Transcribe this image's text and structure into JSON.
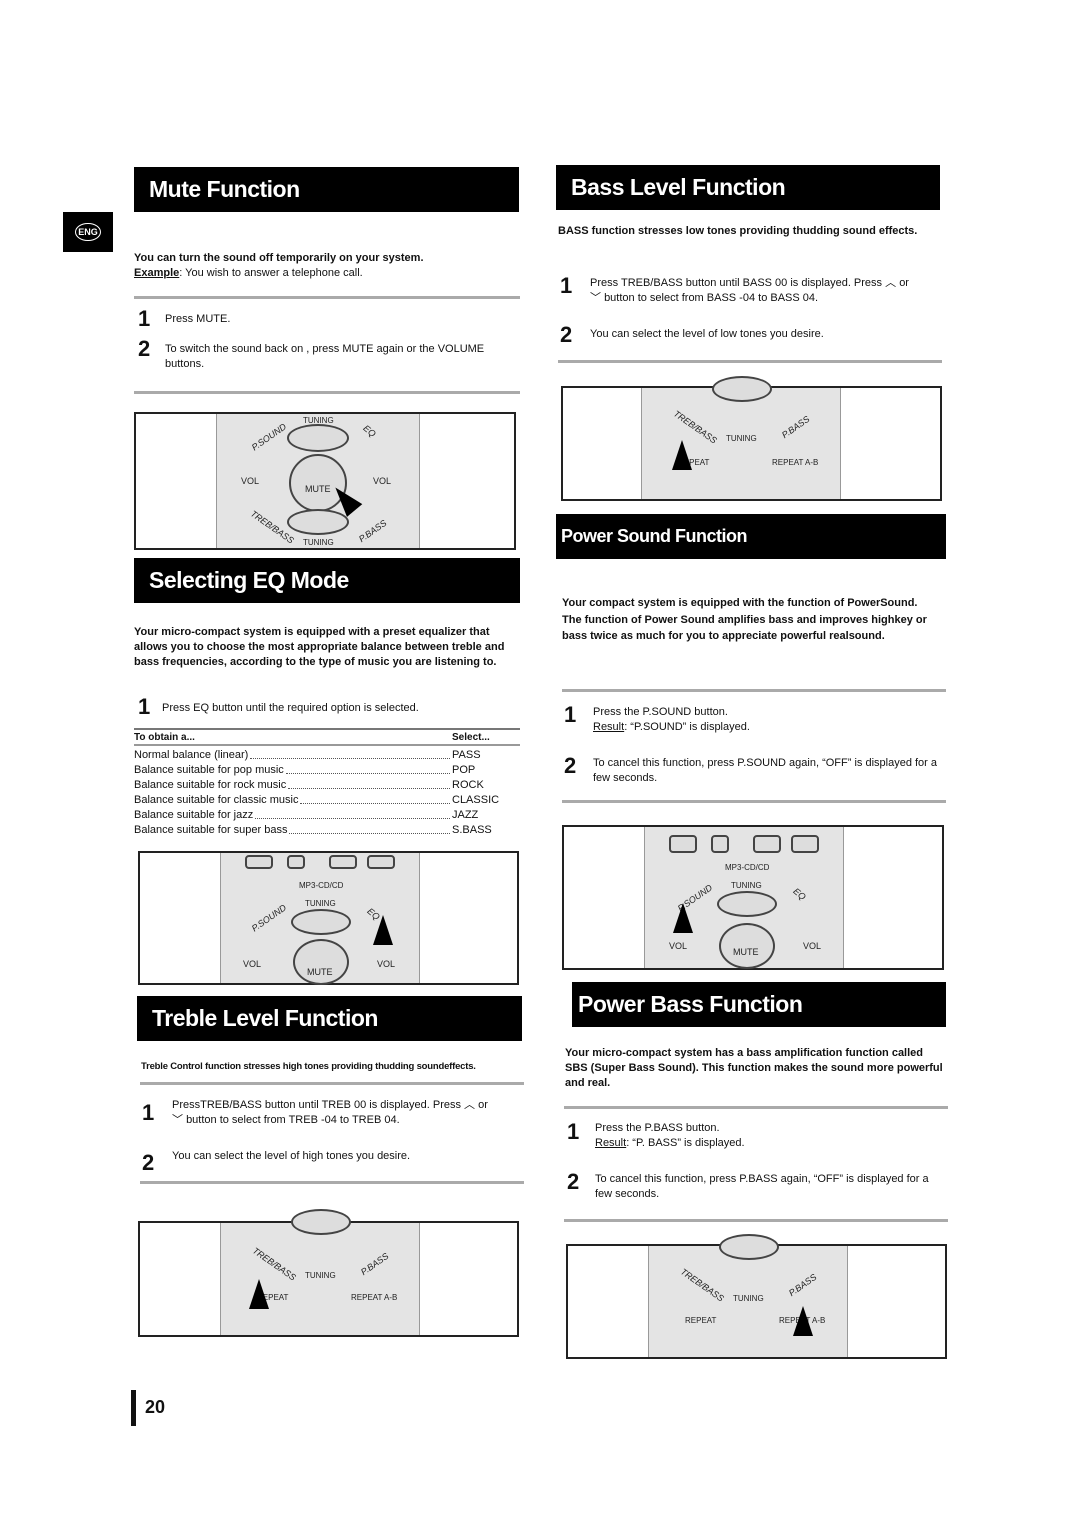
{
  "lang_badge": "ENG",
  "page_number": "20",
  "mute": {
    "title": "Mute Function",
    "intro": "You can turn the sound off temporarily on your system.",
    "example_label": "Example",
    "example_text": ": You wish to answer a telephone call.",
    "step1": "Press MUTE.",
    "step2": "To switch the sound back on , press MUTE again or the VOLUME buttons."
  },
  "eq": {
    "title": "Selecting  EQ Mode",
    "intro": "Your micro-compact system is equipped with a preset equalizer that allows you to choose the most appropriate balance between treble and bass frequencies, according to the type of music you are listening to.",
    "step1": "Press EQ button until the required option is selected.",
    "col_obtain": "To obtain a...",
    "col_select": "Select...",
    "rows": [
      {
        "obtain": "Normal balance (linear)",
        "select": "PASS"
      },
      {
        "obtain": "Balance suitable for pop music",
        "select": "POP"
      },
      {
        "obtain": "Balance suitable for rock music",
        "select": "ROCK"
      },
      {
        "obtain": "Balance suitable for classic music",
        "select": "CLASSIC"
      },
      {
        "obtain": "Balance suitable for jazz",
        "select": "JAZZ"
      },
      {
        "obtain": "Balance suitable for super bass",
        "select": "S.BASS"
      }
    ]
  },
  "treble": {
    "title": "Treble Level Function",
    "intro": "Treble Control function stresses high tones providing thudding soundeffects.",
    "step1a": "PressTREB/BASS  button until TREB 00 is displayed. Press",
    "step1b": "or",
    "step1c": "button to select from TREB -04 to TREB 04.",
    "step2": "You can select the level of high tones you desire."
  },
  "bass": {
    "title": "Bass Level Function",
    "intro": "BASS function stresses low tones providing thudding sound effects.",
    "step1a": "Press TREB/BASS  button until  BASS 00 is displayed.  Press",
    "step1b": "or",
    "step1c": "button to select from BASS -04 to BASS  04.",
    "step2": "You can select the level of low tones you desire."
  },
  "psound": {
    "title": "Power Sound Function",
    "intro1": "Your compact system is equipped with the function of PowerSound.",
    "intro2": "The function of Power Sound amplifies bass and improves highkey or bass twice as much for you to appreciate powerful realsound.",
    "step1": "Press the P.SOUND button.",
    "result_label": "Result",
    "result_text": ": “P.SOUND” is displayed.",
    "step2": "To cancel this function, press P.SOUND again, “OFF” is displayed for a few seconds."
  },
  "pbass": {
    "title": "Power Bass Function",
    "intro": "Your micro-compact system has a bass amplification function called SBS (Super Bass Sound). This function makes the sound more powerful and real.",
    "step1": "Press the P.BASS button.",
    "result_label": "Result",
    "result_text": ": “P. BASS” is displayed.",
    "step2": "To cancel this function, press P.BASS again, “OFF” is displayed  for a few seconds."
  },
  "remote": {
    "tuning": "TUNING",
    "vol": "VOL",
    "mute": "MUTE",
    "psound": "P.SOUND",
    "eq": "EQ",
    "trebbass": "TREB/BASS",
    "pbass": "P.BASS",
    "repeat": "REPEAT",
    "repeat_ab": "REPEAT A-B",
    "mp3cd": "MP3-CD/CD"
  }
}
